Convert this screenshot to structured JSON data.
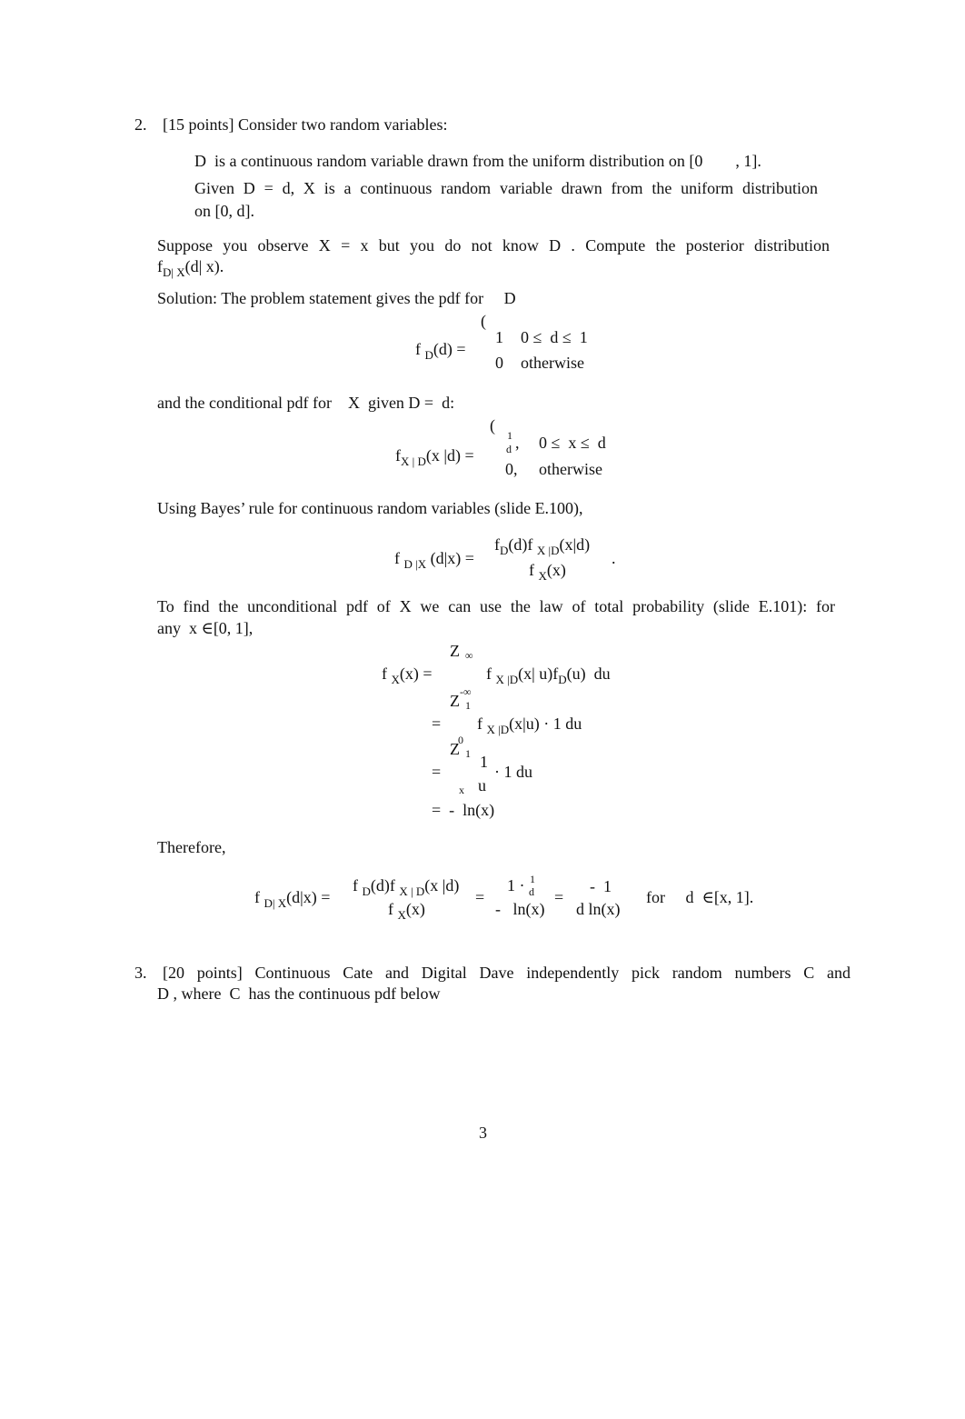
{
  "problem2": {
    "number": "2.",
    "points": "[15 points] Consider two random variables:",
    "bullet1": "D  is a continuous random variable drawn from the uniform distribution on [0        , 1].",
    "bullet2_line1": "Given  D =  d, X  is a continuous random variable drawn from the uniform distribution",
    "bullet2_line2": "on [0, d].",
    "suppose_line1": "Suppose you observe   X  =  x  but you do not know   D .  Compute the posterior distribution",
    "suppose_f": "f",
    "suppose_sub": "D| X",
    "suppose_rest": "(d| x).",
    "solution_intro": "Solution: The problem statement gives the pdf for     D"
  },
  "eq_fD": {
    "lhs_f": "f",
    "lhs_sub": "D",
    "lhs_rest": "(d) =",
    "brace": "(",
    "case1_val": "1",
    "case1_cond": "0 ≤  d ≤  1",
    "case2_val": "0",
    "case2_cond": "otherwise"
  },
  "conditional_intro": "and the conditional pdf for    X  given D =  d:",
  "eq_fXD": {
    "lhs_f": "f",
    "lhs_sub": "X | D",
    "lhs_rest": "(x |d) =",
    "brace": "(",
    "case1_num": "1",
    "case1_den": "d",
    "case1_comma": ",",
    "case1_cond": "0 ≤  x ≤  d",
    "case2_val": "0,",
    "case2_cond": "otherwise"
  },
  "bayes_intro": "Using Bayes’ rule for continuous random variables (slide E.100),",
  "eq_bayes": {
    "lhs_f": "f",
    "lhs_sub": "D |X",
    "lhs_rest": "(d|x) =",
    "num": "f D (d)f X |D (x|d)",
    "num_parts": [
      "f",
      "D",
      "(d)f",
      "X |D",
      "(x|d)"
    ],
    "den_parts": [
      "f",
      "X",
      "(x)"
    ],
    "period": "."
  },
  "total_prob_line1": "To find the unconditional pdf of    X  we can use the law of total probability (slide E.101): for",
  "total_prob_line2": "any  x ∈[0, 1],",
  "eq_fX": {
    "lhs_f": "f",
    "lhs_sub": "X",
    "lhs_rest": "(x) =",
    "int_sym": "Z",
    "row1_upper": "∞",
    "row1_lower": "-∞",
    "row1_body_parts": [
      "f",
      "X |D",
      "(x| u)f",
      "D",
      "(u)  du"
    ],
    "row2_eq": "=",
    "row2_upper": "1",
    "row2_lower": "0",
    "row2_body_parts": [
      "f",
      "X |D",
      "(x|u) · 1 du"
    ],
    "row3_eq": "=",
    "row3_upper": "1",
    "row3_lower": "x",
    "row3_num": "1",
    "row3_den": "u",
    "row3_rest": "· 1 du",
    "row4": "=  -  ln(x)"
  },
  "therefore": "Therefore,",
  "eq_final": {
    "lhs_f": "f",
    "lhs_sub": "D| X",
    "lhs_rest": "(d|x) =",
    "frac1_num_parts": [
      "f",
      "D",
      "(d)f",
      "X | D",
      "(x |d)"
    ],
    "frac1_den_parts": [
      "f",
      "X",
      "(x)"
    ],
    "eq1": "=",
    "frac2_num": "1 ·",
    "frac2_num_small_num": "1",
    "frac2_num_small_den": "d",
    "frac2_den": "-   ln(x)",
    "eq2": "=",
    "frac3_num": "-  1",
    "frac3_den": "d ln(x)",
    "condition": "for     d  ∈[x, 1]."
  },
  "problem3": {
    "number": "3.",
    "line1": "[20 points] Continuous Cate and Digital Dave independently pick random numbers          C  and",
    "line2": "D , where  C  has the continuous pdf below"
  },
  "page_number": "3"
}
